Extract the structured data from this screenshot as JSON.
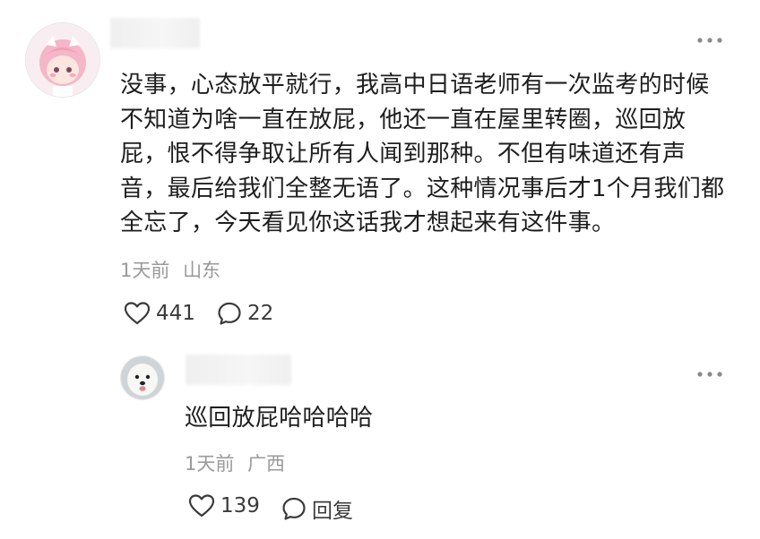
{
  "comment": {
    "avatar_icon": "cartoon-girl-avatar",
    "username": "",
    "body": "没事，心态放平就行，我高中日语老师有一次监考的时候不知道为啥一直在放屁，他还一直在屋里转圈，巡回放屁，恨不得争取让所有人闻到那种。不但有味道还有声音，最后给我们全整无语了。这种情况事后才1个月我们都全忘了，今天看见你这话我才想起来有这件事。",
    "time": "1天前",
    "location": "山东",
    "likes": "441",
    "replies": "22"
  },
  "reply": {
    "avatar_icon": "white-dog-avatar",
    "username": "",
    "body": "巡回放屁哈哈哈哈",
    "time": "1天前",
    "location": "广西",
    "likes": "139",
    "reply_label": "回复"
  },
  "icons": {
    "more": "more-horizontal-icon",
    "like": "heart-outline-icon",
    "comment": "speech-bubble-icon"
  }
}
